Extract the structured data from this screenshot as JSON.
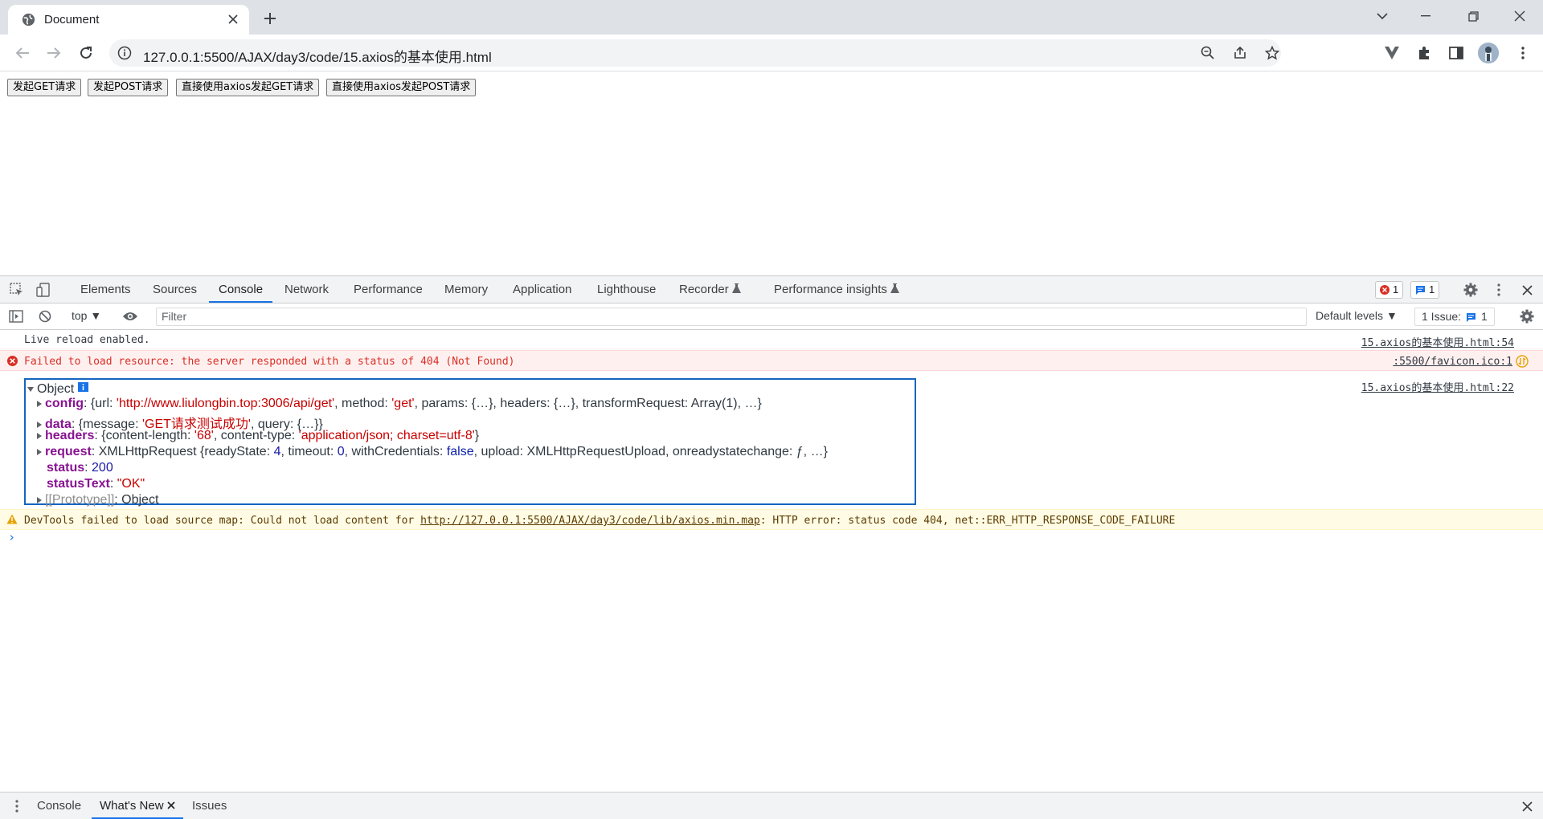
{
  "browser": {
    "tab_title": "Document",
    "url": "127.0.0.1:5500/AJAX/day3/code/15.axios的基本使用.html"
  },
  "page": {
    "buttons": [
      "发起GET请求",
      "发起POST请求",
      "直接使用axios发起GET请求",
      "直接使用axios发起POST请求"
    ]
  },
  "devtools": {
    "tabs": [
      "Elements",
      "Sources",
      "Console",
      "Network",
      "Performance",
      "Memory",
      "Application",
      "Lighthouse",
      "Recorder",
      "Performance insights"
    ],
    "active_tab": "Console",
    "error_count": "1",
    "message_count": "1",
    "context": "top",
    "filter_placeholder": "Filter",
    "levels": "Default levels",
    "issues_label": "1 Issue:",
    "issues_count": "1"
  },
  "console": {
    "line1": {
      "text": "Live reload enabled.",
      "source": "15.axios的基本使用.html:54"
    },
    "line2": {
      "text": "Failed to load resource: the server responded with a status of 404 (Not Found)",
      "source": ":5500/favicon.ico:1"
    },
    "object": {
      "header": "Object",
      "source": "15.axios的基本使用.html:22",
      "config": {
        "key": "config",
        "pre": ": {url: ",
        "url": "'http://www.liulongbin.top:3006/api/get'",
        "mid": ", method: ",
        "method": "'get'",
        "post": ", params: {…}, headers: {…}, transformRequest: Array(1), …}"
      },
      "data": {
        "key": "data",
        "pre": ": {message: ",
        "message": "'GET请求测试成功'",
        "post": ", query: {…}}"
      },
      "headers": {
        "key": "headers",
        "pre": ": {content-length: ",
        "length": "'68'",
        "mid": ", content-type: ",
        "type": "'application/json; charset=utf-8'",
        "post": "}"
      },
      "request": {
        "key": "request",
        "pre": ": XMLHttpRequest {readyState: ",
        "ready": "4",
        "mid1": ", timeout: ",
        "timeout": "0",
        "mid2": ", withCredentials: ",
        "creds": "false",
        "post": ", upload: XMLHttpRequestUpload, onreadystatechange: ƒ, …}"
      },
      "status": {
        "key": "status",
        "value": "200"
      },
      "statusText": {
        "key": "statusText",
        "value": "\"OK\""
      },
      "prototype": {
        "key": "[[Prototype]]",
        "value": ": Object"
      }
    },
    "warning": {
      "pre": "DevTools failed to load source map: Could not load content for ",
      "link": "http://127.0.0.1:5500/AJAX/day3/code/lib/axios.min.map",
      "post": ": HTTP error: status code 404, net::ERR_HTTP_RESPONSE_CODE_FAILURE"
    },
    "prompt": "›"
  },
  "drawer": {
    "tabs": [
      "Console",
      "What's New",
      "Issues"
    ],
    "active_tab": "What's New"
  }
}
